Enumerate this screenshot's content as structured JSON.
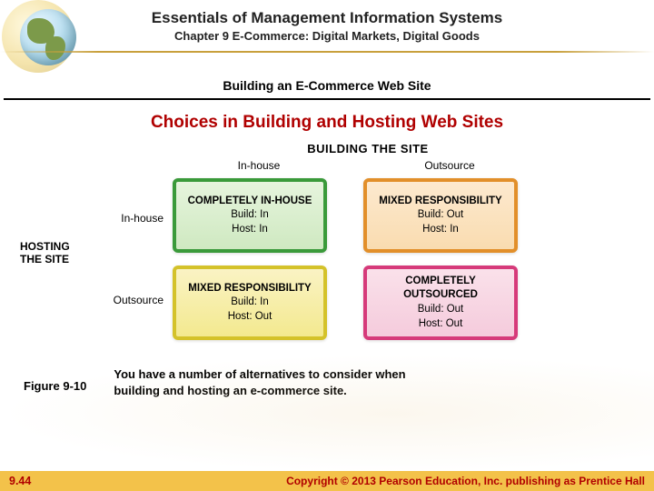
{
  "header": {
    "book_title": "Essentials of Management Information Systems",
    "chapter": "Chapter 9 E-Commerce: Digital Markets, Digital Goods",
    "section_title": "Building an E-Commerce Web Site"
  },
  "slide_title": "Choices in Building and Hosting Web Sites",
  "matrix": {
    "top_label": "BUILDING THE SITE",
    "left_label": "HOSTING THE SITE",
    "col_headers": [
      "In-house",
      "Outsource"
    ],
    "row_headers": [
      "In-house",
      "Outsource"
    ],
    "cells": [
      {
        "title": "COMPLETELY IN-HOUSE",
        "line1": "Build: In",
        "line2": "Host: In"
      },
      {
        "title": "MIXED RESPONSIBILITY",
        "line1": "Build: Out",
        "line2": "Host: In"
      },
      {
        "title": "MIXED RESPONSIBILITY",
        "line1": "Build: In",
        "line2": "Host: Out"
      },
      {
        "title": "COMPLETELY OUTSOURCED",
        "line1": "Build: Out",
        "line2": "Host: Out"
      }
    ]
  },
  "figure_number": "Figure 9-10",
  "caption": "You have a number of alternatives to consider when building and hosting an e-commerce site.",
  "footer": {
    "page": "9.44",
    "copyright": "Copyright © 2013 Pearson Education, Inc. publishing as Prentice Hall"
  }
}
